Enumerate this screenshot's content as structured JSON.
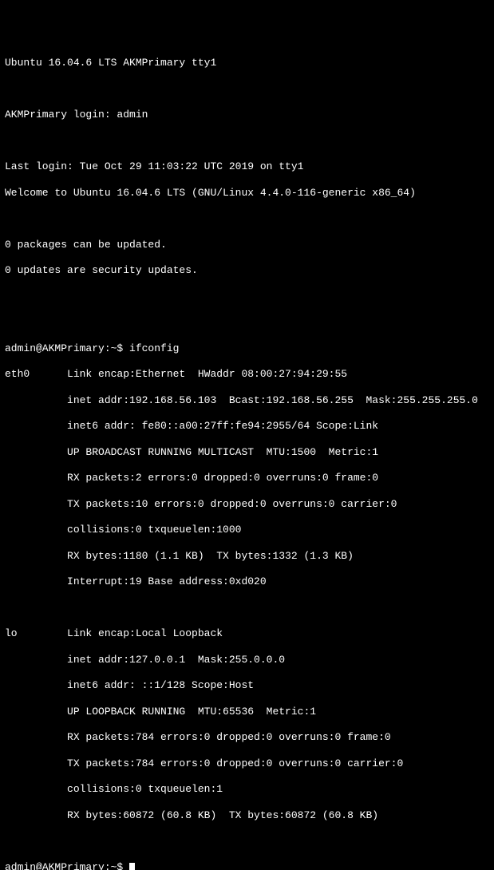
{
  "header": {
    "banner": "Ubuntu 16.04.6 LTS AKMPrimary tty1",
    "login_prompt": "AKMPrimary login: admin",
    "last_login": "Last login: Tue Oct 29 11:03:22 UTC 2019 on tty1",
    "welcome": "Welcome to Ubuntu 16.04.6 LTS (GNU/Linux 4.4.0-116-generic x86_64)",
    "updates1": "0 packages can be updated.",
    "updates2": "0 updates are security updates."
  },
  "prompt1": {
    "user_host": "admin@AKMPrimary:~$ ",
    "command": "ifconfig"
  },
  "ifconfig": {
    "eth0": {
      "l1": "eth0      Link encap:Ethernet  HWaddr 08:00:27:94:29:55",
      "l2": "          inet addr:192.168.56.103  Bcast:192.168.56.255  Mask:255.255.255.0",
      "l3": "          inet6 addr: fe80::a00:27ff:fe94:2955/64 Scope:Link",
      "l4": "          UP BROADCAST RUNNING MULTICAST  MTU:1500  Metric:1",
      "l5": "          RX packets:2 errors:0 dropped:0 overruns:0 frame:0",
      "l6": "          TX packets:10 errors:0 dropped:0 overruns:0 carrier:0",
      "l7": "          collisions:0 txqueuelen:1000",
      "l8": "          RX bytes:1180 (1.1 KB)  TX bytes:1332 (1.3 KB)",
      "l9": "          Interrupt:19 Base address:0xd020"
    },
    "lo": {
      "l1": "lo        Link encap:Local Loopback",
      "l2": "          inet addr:127.0.0.1  Mask:255.0.0.0",
      "l3": "          inet6 addr: ::1/128 Scope:Host",
      "l4": "          UP LOOPBACK RUNNING  MTU:65536  Metric:1",
      "l5": "          RX packets:784 errors:0 dropped:0 overruns:0 frame:0",
      "l6": "          TX packets:784 errors:0 dropped:0 overruns:0 carrier:0",
      "l7": "          collisions:0 txqueuelen:1",
      "l8": "          RX bytes:60872 (60.8 KB)  TX bytes:60872 (60.8 KB)"
    }
  },
  "prompt2": {
    "user_host": "admin@AKMPrimary:~$ "
  }
}
